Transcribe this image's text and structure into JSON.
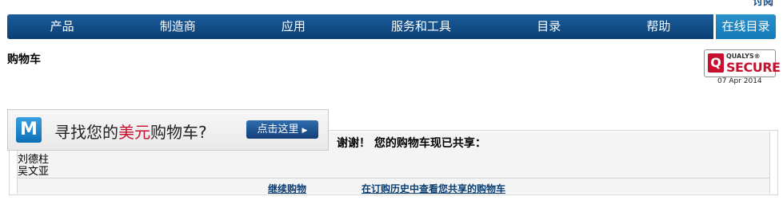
{
  "header": {
    "corner_text": "讨阅"
  },
  "nav": {
    "items": [
      "产品",
      "制造商",
      "应用",
      "服务和工具",
      "目录",
      "帮助"
    ],
    "catalog_label": "在线目录"
  },
  "page": {
    "title": "购物车"
  },
  "qualys": {
    "q": "Q",
    "name": "QUALYS®",
    "secure": "SECURE",
    "date": "07 Apr 2014"
  },
  "banner": {
    "logo": "M",
    "text_before": "寻找您的",
    "text_accent": "美元",
    "text_after": "购物车?",
    "button_label": "点击这里",
    "accent_color": "#c8102e"
  },
  "cart": {
    "thanks_message": "谢谢！ 您的购物车现已共享：",
    "names": [
      "刘德柱",
      "吴文亚"
    ],
    "links": {
      "continue": "继续购物",
      "history": "在订购历史中查看您共享的购物车"
    }
  }
}
